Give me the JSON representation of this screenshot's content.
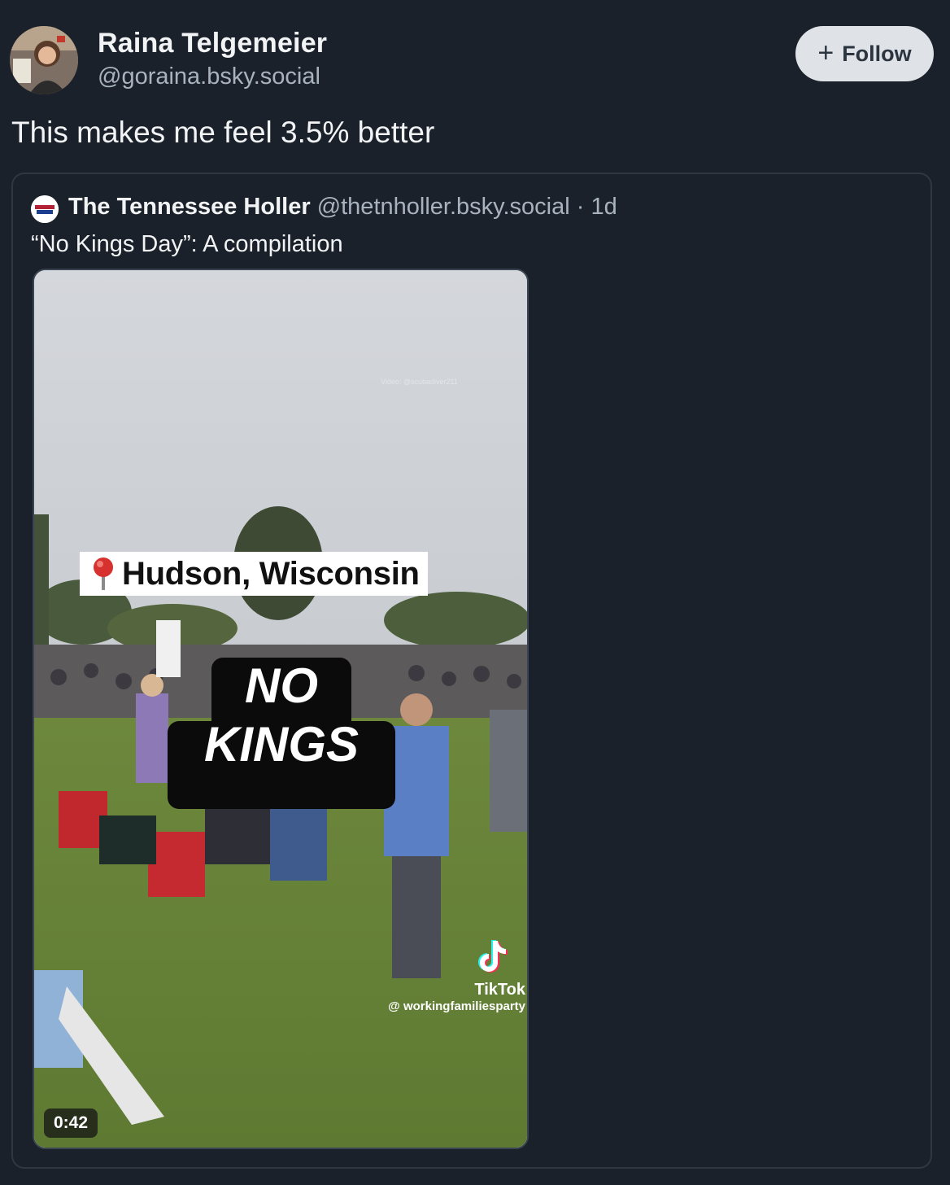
{
  "author": {
    "display_name": "Raina Telgemeier",
    "handle": "@goraina.bsky.social",
    "avatar_icon": "user-avatar"
  },
  "follow_button": {
    "label": "Follow",
    "icon": "plus-icon"
  },
  "post": {
    "text": "This makes me feel 3.5% better"
  },
  "quoted_post": {
    "author_name": "The Tennessee Holler",
    "author_handle": "@thetnholler.bsky.social",
    "separator": "·",
    "age": "1d",
    "text": "“No Kings Day”: A compilation",
    "video": {
      "location_caption": "Hudson, Wisconsin",
      "overlay_line1": "NO",
      "overlay_line2": "KINGS",
      "watermark": "Video: @scubadiver211",
      "tiktok_brand": "TikTok",
      "tiktok_user": "@ workingfamiliesparty",
      "duration": "0:42"
    }
  },
  "colors": {
    "background": "#1b212a",
    "button_bg": "#dfe3e8",
    "muted_text": "#a9b3bf"
  }
}
